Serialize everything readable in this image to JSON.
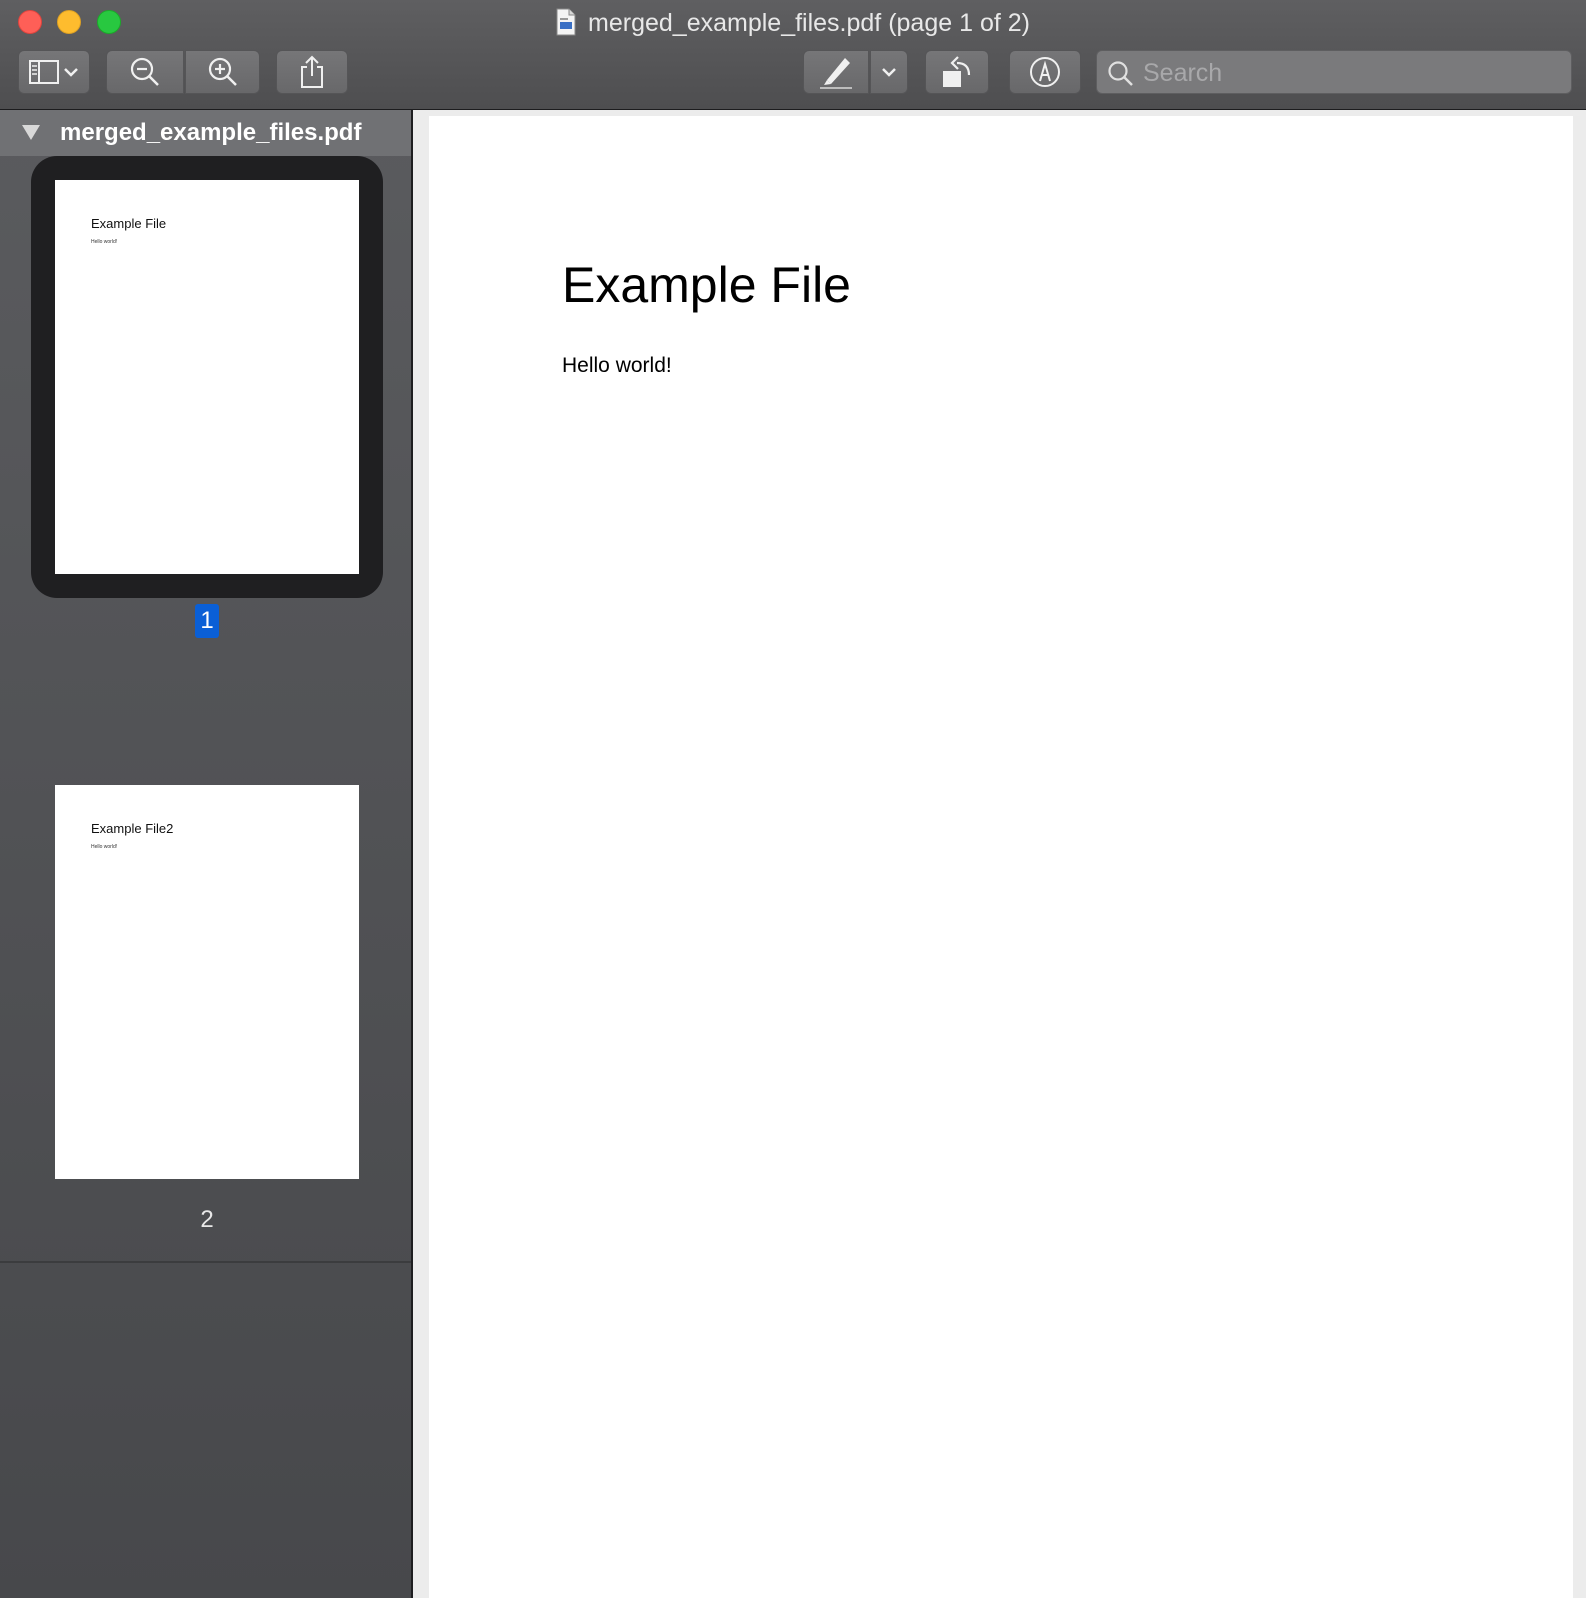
{
  "window": {
    "title": "merged_example_files.pdf (page 1 of 2)"
  },
  "toolbar": {
    "buttons": [
      {
        "name": "sidebar-toggle",
        "icon": "sidebar-icon"
      },
      {
        "name": "zoom-out",
        "icon": "zoom-out-icon"
      },
      {
        "name": "zoom-in",
        "icon": "zoom-in-icon"
      },
      {
        "name": "share",
        "icon": "share-icon"
      },
      {
        "name": "highlight",
        "icon": "highlighter-icon"
      },
      {
        "name": "rotate",
        "icon": "rotate-left-icon"
      },
      {
        "name": "markup",
        "icon": "markup-pen-icon"
      }
    ],
    "search_placeholder": "Search"
  },
  "sidebar": {
    "document_name": "merged_example_files.pdf",
    "pages": [
      {
        "number": "1",
        "title": "Example File",
        "body": "Hello world!",
        "selected": true
      },
      {
        "number": "2",
        "title": "Example File2",
        "body": "Hello world!",
        "selected": false
      }
    ]
  },
  "document": {
    "title": "Example File",
    "body": "Hello world!"
  },
  "colors": {
    "selection_accent": "#0a5fd6",
    "close": "#fe5f57",
    "minimize": "#febc2e",
    "maximize": "#28c840"
  }
}
